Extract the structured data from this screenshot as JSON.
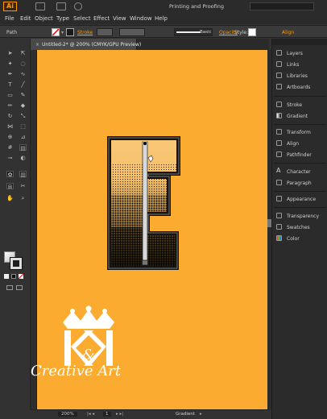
{
  "app": {
    "logo": "Ai",
    "workspace": "Printing and Proofing",
    "menus": [
      "File",
      "Edit",
      "Object",
      "Type",
      "Select",
      "Effect",
      "View",
      "Window",
      "Help"
    ]
  },
  "control_bar": {
    "selection": "Path",
    "stroke_label": "Stroke",
    "stroke_style": "Basic",
    "opacity_label": "Opacity",
    "style_label": "Style:",
    "align_label": "Align"
  },
  "document_tab": {
    "title": "Untitled-2* @ 200% (CMYK/GPU Preview)"
  },
  "status_bar": {
    "zoom": "200%",
    "page": "1",
    "tool": "Gradient"
  },
  "panels": [
    "Layers",
    "Links",
    "Libraries",
    "Artboards",
    "Stroke",
    "Gradient",
    "Transform",
    "Align",
    "Pathfinder",
    "Character",
    "Paragraph",
    "Appearance",
    "Transparency",
    "Swatches",
    "Color"
  ],
  "watermark": {
    "monogram": "K&K",
    "title": "Creative Art"
  },
  "colors": {
    "artboard": "#fbab30",
    "accent": "#ff9a00",
    "chrome": "#323232",
    "letter_outline": "#141414",
    "letter_fill": "#f8c877"
  },
  "icons": [
    "selection-tool-icon",
    "direct-selection-tool-icon",
    "magic-wand-icon",
    "lasso-icon",
    "pen-icon",
    "curvature-icon",
    "type-icon",
    "line-icon",
    "rectangle-icon",
    "paintbrush-icon",
    "pencil-icon",
    "eraser-icon",
    "rotate-icon",
    "scale-icon",
    "width-icon",
    "free-transform-icon",
    "shape-builder-icon",
    "perspective-icon",
    "mesh-icon",
    "gradient-icon",
    "eyedropper-icon",
    "blend-icon",
    "symbol-sprayer-icon",
    "graph-icon",
    "artboard-icon",
    "slice-icon",
    "hand-icon",
    "zoom-icon"
  ]
}
